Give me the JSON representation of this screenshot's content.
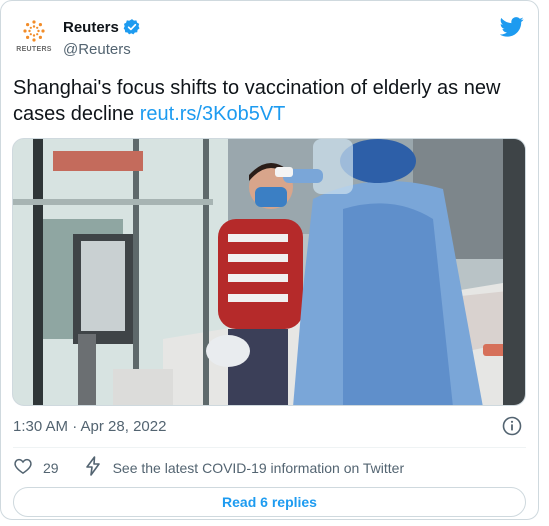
{
  "author": {
    "display_name": "Reuters",
    "handle": "@Reuters",
    "logo_text": "REUTERS",
    "verified": true
  },
  "tweet": {
    "text": "Shanghai's focus shifts to vaccination of elderly as new cases decline",
    "link": "reut.rs/3Kob5VT",
    "timestamp": "1:30 AM · Apr 28, 2022"
  },
  "media": {
    "icon": "photo"
  },
  "actions": {
    "like_count": "29",
    "covid_info": "See the latest COVID-19 information on Twitter",
    "read_replies": "Read 6 replies"
  },
  "colors": {
    "accent": "#1d9bf0",
    "text": "#0f1419",
    "secondary": "#536471",
    "border": "#cfd9de"
  }
}
